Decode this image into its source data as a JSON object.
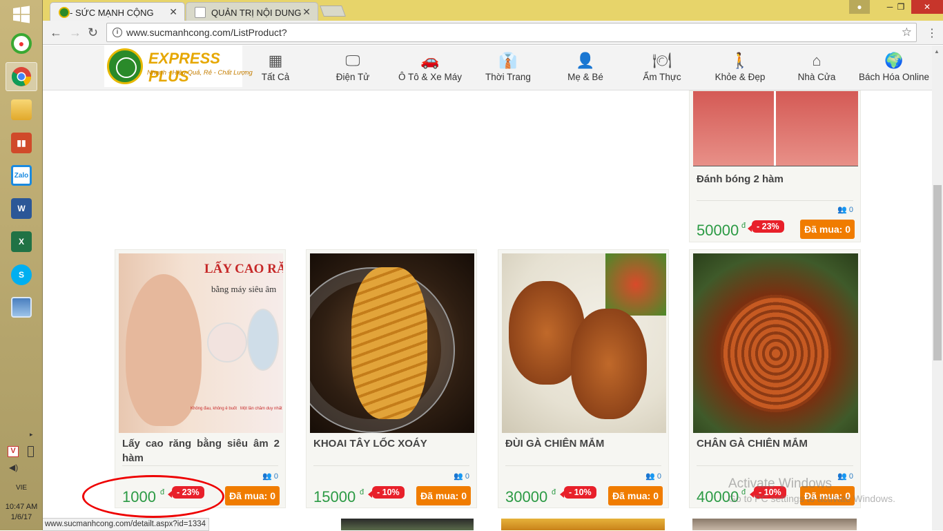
{
  "taskbar": {
    "time": "10:47 AM",
    "date": "1/6/17",
    "lang": "VIE",
    "apps": [
      "start-icon",
      "app-green-icon",
      "chrome-icon",
      "file-explorer-icon",
      "foxit-icon",
      "zalo-icon",
      "word-icon",
      "excel-icon",
      "skype-icon",
      "photos-icon"
    ],
    "zalo_label": "Zalo"
  },
  "browser": {
    "tabs": [
      {
        "title": "- SỨC MẠNH CỘNG",
        "active": true
      },
      {
        "title": "QUẢN TRỊ NỘI DUNG",
        "active": false
      }
    ],
    "url": "www.sucmanhcong.com/ListProduct?",
    "status_url": "www.sucmanhcong.com/detailt.aspx?id=1334"
  },
  "site": {
    "logo_brand": "EXPRESS PLUS",
    "logo_slogan": "Nhanh - Hiệu Quả, Rẻ - Chất Lượng",
    "categories": [
      {
        "label": "Tất Cả",
        "icon": "grid-icon"
      },
      {
        "label": "Điện Tử",
        "icon": "monitor-icon"
      },
      {
        "label": "Ô Tô & Xe Máy",
        "icon": "car-icon"
      },
      {
        "label": "Thời Trang",
        "icon": "fashion-icon"
      },
      {
        "label": "Mẹ & Bé",
        "icon": "person-icon"
      },
      {
        "label": "Ẩm Thực",
        "icon": "dining-icon"
      },
      {
        "label": "Khỏe & Đẹp",
        "icon": "figure-icon"
      },
      {
        "label": "Nhà Cửa",
        "icon": "house-icon"
      },
      {
        "label": "Bách Hóa Online",
        "icon": "globe-icon"
      }
    ]
  },
  "products": [
    {
      "name": "Đánh bóng 2 hàm",
      "buyers": "0",
      "price": "50000",
      "currency": "đ",
      "discount": "- 23%",
      "bought": "Đã mua: 0"
    },
    {
      "name": "Lấy cao răng bằng siêu âm 2 hàm",
      "buyers": "0",
      "price": "1000",
      "currency": "đ",
      "discount": "- 23%",
      "bought": "Đã mua: 0",
      "img_text_title": "LẤY CAO RĂNG",
      "img_text_sub": "bằng máy siêu âm",
      "img_text_foot1": "Không đau, không ê buốt",
      "img_text_foot2": "Một lần chăm duy nhất"
    },
    {
      "name": "KHOAI TÂY LỐC XOÁY",
      "buyers": "0",
      "price": "15000",
      "currency": "đ",
      "discount": "- 10%",
      "bought": "Đã mua: 0"
    },
    {
      "name": "ĐÙI GÀ CHIÊN MẮM",
      "buyers": "0",
      "price": "30000",
      "currency": "đ",
      "discount": "- 10%",
      "bought": "Đã mua: 0"
    },
    {
      "name": "CHÂN GÀ CHIÊN MẮM",
      "buyers": "0",
      "price": "40000",
      "currency": "đ",
      "discount": "- 10%",
      "bought": "Đã mua: 0"
    }
  ],
  "watermark": {
    "line1": "Activate Windows",
    "line2": "Go to PC settings to activate Windows."
  },
  "colors": {
    "price_green": "#2b9a44",
    "discount_red": "#e8202a",
    "bought_orange": "#f07c00",
    "annotation_red": "#e00000"
  }
}
